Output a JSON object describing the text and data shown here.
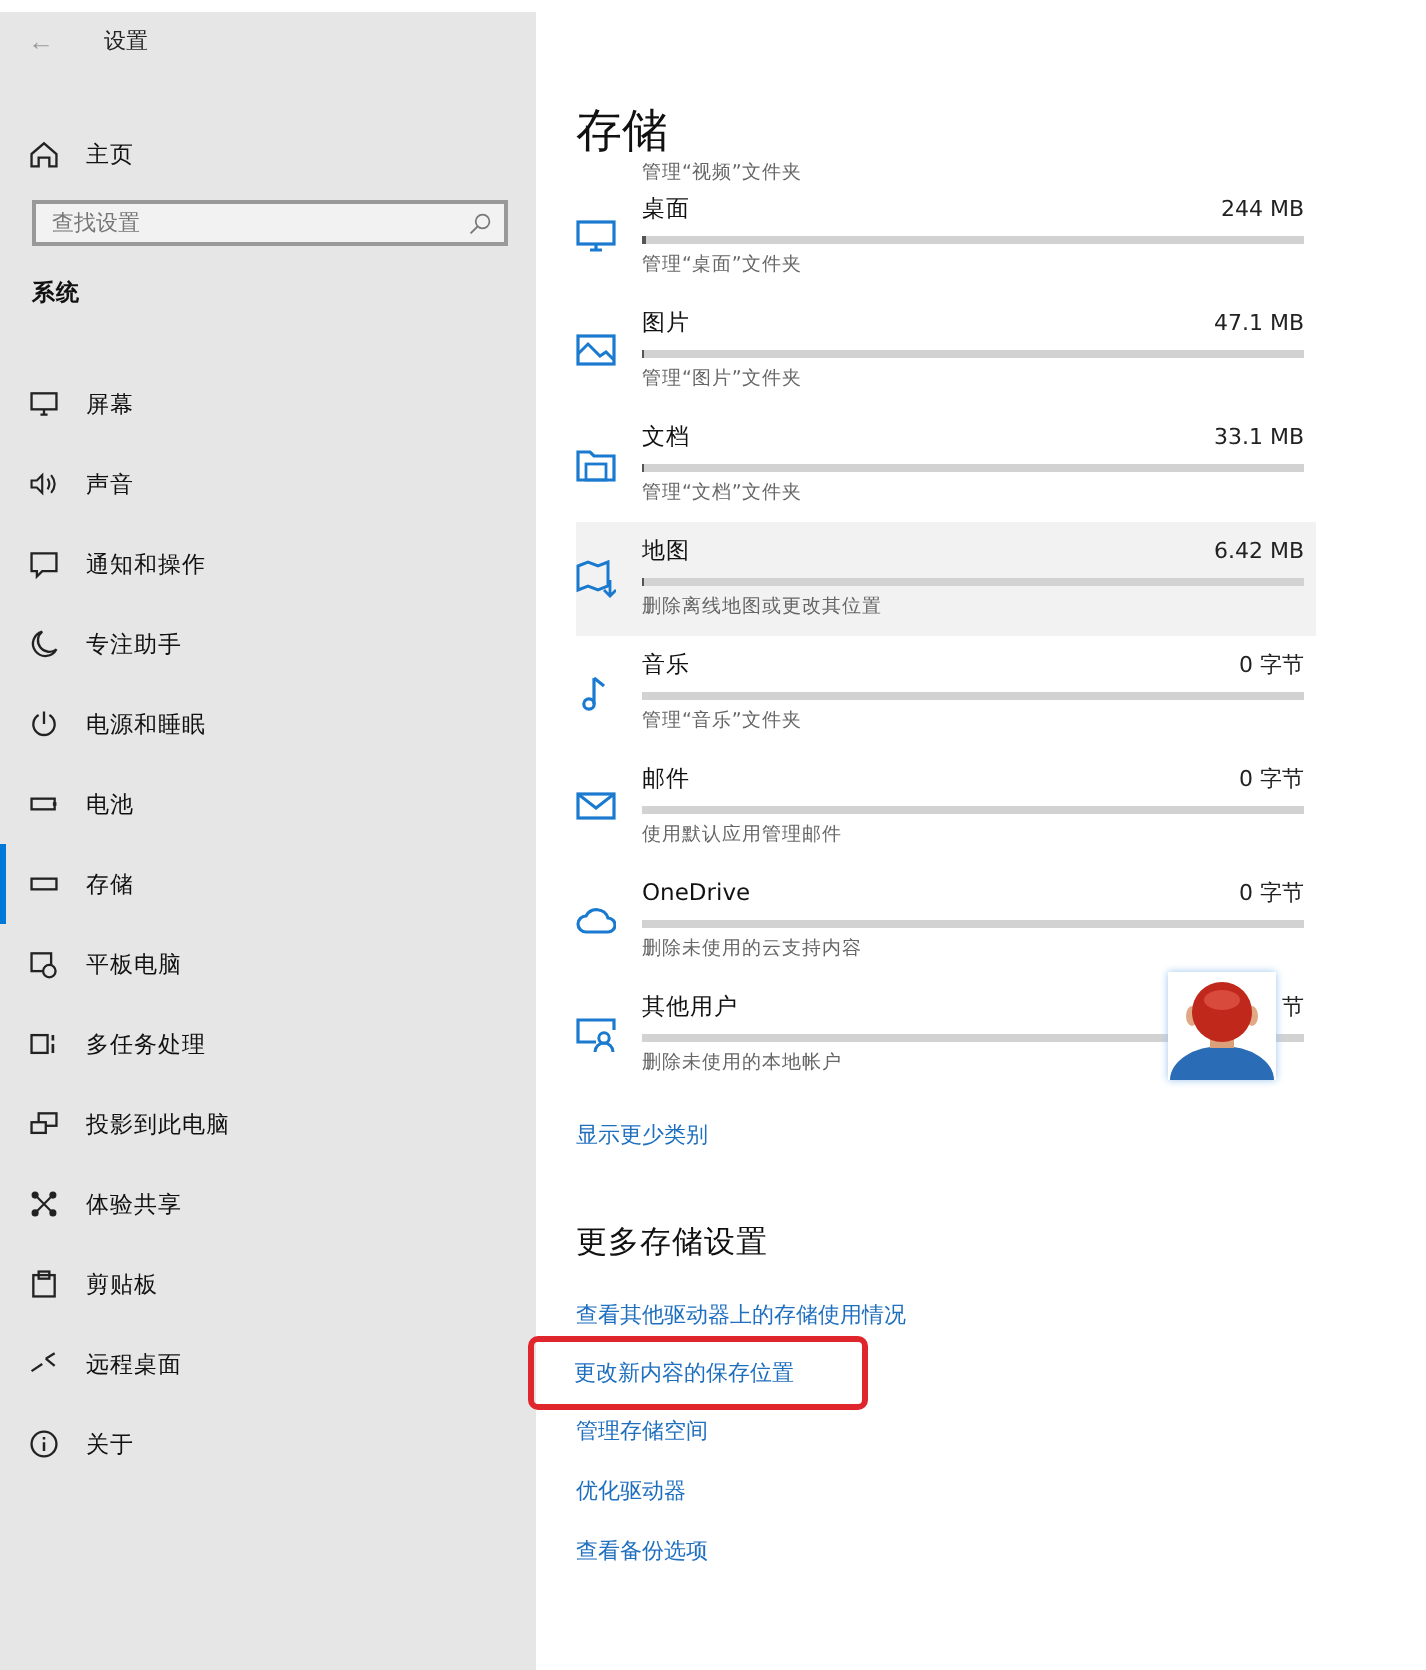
{
  "window": {
    "back": "←",
    "title": "设置"
  },
  "sidebar": {
    "home": "主页",
    "search": {
      "placeholder": "查找设置"
    },
    "section": "系统",
    "items": [
      {
        "label": "屏幕",
        "selected": false
      },
      {
        "label": "声音",
        "selected": false
      },
      {
        "label": "通知和操作",
        "selected": false
      },
      {
        "label": "专注助手",
        "selected": false
      },
      {
        "label": "电源和睡眠",
        "selected": false
      },
      {
        "label": "电池",
        "selected": false
      },
      {
        "label": "存储",
        "selected": true
      },
      {
        "label": "平板电脑",
        "selected": false
      },
      {
        "label": "多任务处理",
        "selected": false
      },
      {
        "label": "投影到此电脑",
        "selected": false
      },
      {
        "label": "体验共享",
        "selected": false
      },
      {
        "label": "剪贴板",
        "selected": false
      },
      {
        "label": "远程桌面",
        "selected": false
      },
      {
        "label": "关于",
        "selected": false
      }
    ]
  },
  "main": {
    "title": "存储",
    "clipped_caption": "管理“视频”文件夹",
    "categories": [
      {
        "name": "桌面",
        "size": "244 MB",
        "level": 0.006,
        "caption": "管理“桌面”文件夹",
        "hovered": false
      },
      {
        "name": "图片",
        "size": "47.1 MB",
        "level": 0.002,
        "caption": "管理“图片”文件夹",
        "hovered": false
      },
      {
        "name": "文档",
        "size": "33.1 MB",
        "level": 0.002,
        "caption": "管理“文档”文件夹",
        "hovered": false
      },
      {
        "name": "地图",
        "size": "6.42 MB",
        "level": 0.001,
        "caption": "删除离线地图或更改其位置",
        "hovered": true
      },
      {
        "name": "音乐",
        "size": "0 字节",
        "caption": "管理“音乐”文件夹",
        "hovered": false
      },
      {
        "name": "邮件",
        "size": "0 字节",
        "caption": "使用默认应用管理邮件",
        "hovered": false
      },
      {
        "name": "OneDrive",
        "size": "0 字节",
        "caption": "删除未使用的云支持内容",
        "hovered": false
      },
      {
        "name": "其他用户",
        "size": "节",
        "caption": "删除未使用的本地帐户",
        "hovered": false
      }
    ],
    "show_less": "显示更少类别",
    "more_title": "更多存储设置",
    "links": [
      {
        "label": "查看其他驱动器上的存储使用情况",
        "highlighted": false
      },
      {
        "label": "更改新内容的保存位置",
        "highlighted": true
      },
      {
        "label": "管理存储空间",
        "highlighted": false
      },
      {
        "label": "优化驱动器",
        "highlighted": false
      },
      {
        "label": "查看备份选项",
        "highlighted": false
      }
    ]
  }
}
